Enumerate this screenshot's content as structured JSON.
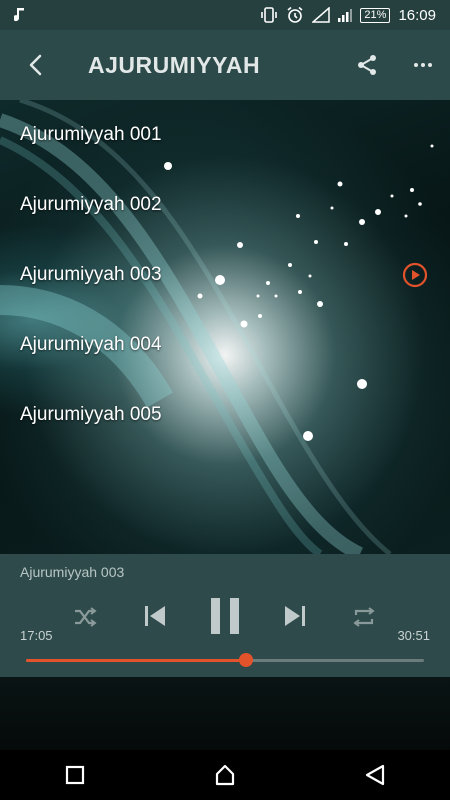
{
  "status_bar": {
    "time": "16:09",
    "battery": "21%",
    "icons": [
      "music-note-icon",
      "vibrate-icon",
      "alarm-icon",
      "signal-icon",
      "battery-icon"
    ]
  },
  "app_bar": {
    "title": "AJURUMIYYAH",
    "icons": [
      "back-arrow-icon",
      "share-icon",
      "more-vert-icon"
    ]
  },
  "playlist": {
    "items": [
      {
        "label": "Ajurumiyyah 001",
        "playing": false
      },
      {
        "label": "Ajurumiyyah 002",
        "playing": false
      },
      {
        "label": "Ajurumiyyah 003",
        "playing": true
      },
      {
        "label": "Ajurumiyyah 004",
        "playing": false
      },
      {
        "label": "Ajurumiyyah 005",
        "playing": false
      }
    ]
  },
  "player": {
    "now_playing": "Ajurumiyyah 003",
    "current_time": "17:05",
    "total_time": "30:51",
    "progress_fraction": 0.554,
    "accent_color": "#e3532b",
    "controls": [
      "shuffle-icon",
      "previous-icon",
      "pause-icon",
      "next-icon",
      "repeat-icon"
    ]
  },
  "nav_bar": {
    "icons": [
      "recents-square-icon",
      "home-icon",
      "back-triangle-icon"
    ]
  }
}
